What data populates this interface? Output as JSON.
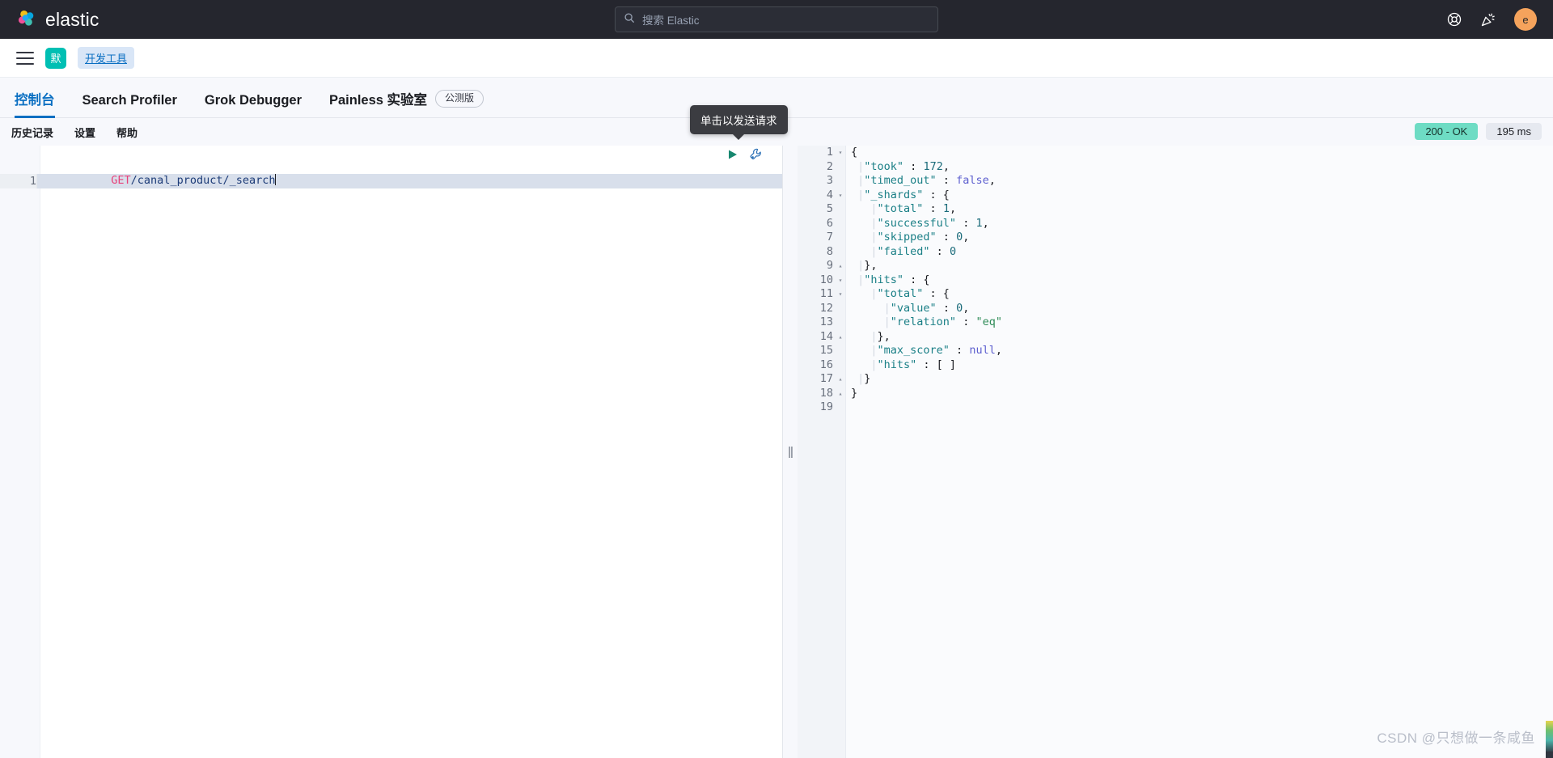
{
  "header": {
    "brand_name": "elastic",
    "logo_icon": "elastic-logo-icon",
    "search": {
      "placeholder": "搜索 Elastic",
      "value": "",
      "icon": "search-icon"
    },
    "help_icon": "lifebuoy-help-icon",
    "news_icon": "party-popper-news-icon",
    "avatar_initial": "e",
    "avatar_color": "#f5a35c",
    "background_color": "#25262e"
  },
  "breadcrumb": {
    "menu_icon": "hamburger-menu-icon",
    "space_badge": "默",
    "space_badge_color": "#00bfb3",
    "link_label": "开发工具"
  },
  "tabs": [
    {
      "label": "控制台",
      "active": true
    },
    {
      "label": "Search Profiler",
      "active": false
    },
    {
      "label": "Grok Debugger",
      "active": false
    },
    {
      "label": "Painless 实验室",
      "active": false,
      "badge": "公测版"
    }
  ],
  "console_toolbar": {
    "links": [
      "历史记录",
      "设置",
      "帮助"
    ],
    "status_code": "200 - OK",
    "status_color": "#6edcc4",
    "response_time": "195 ms"
  },
  "tooltip": {
    "text": "单击以发送请求"
  },
  "request_editor": {
    "line_number": "1",
    "method": "GET",
    "path": "/canal_product/_search",
    "send_icon": "play-send-request-icon",
    "wrench_icon": "wrench-options-icon",
    "splitter_icon": "drag-handle-icon"
  },
  "response_editor": {
    "lines": [
      {
        "n": "1",
        "fold": "▾",
        "indent": 0,
        "tokens": [
          {
            "t": "{",
            "c": "j-punc"
          }
        ]
      },
      {
        "n": "2",
        "fold": "",
        "indent": 1,
        "tokens": [
          {
            "t": "\"took\"",
            "c": "j-key"
          },
          {
            "t": " : ",
            "c": "j-punc"
          },
          {
            "t": "172",
            "c": "j-num"
          },
          {
            "t": ",",
            "c": "j-punc"
          }
        ]
      },
      {
        "n": "3",
        "fold": "",
        "indent": 1,
        "tokens": [
          {
            "t": "\"timed_out\"",
            "c": "j-key"
          },
          {
            "t": " : ",
            "c": "j-punc"
          },
          {
            "t": "false",
            "c": "j-lit"
          },
          {
            "t": ",",
            "c": "j-punc"
          }
        ]
      },
      {
        "n": "4",
        "fold": "▾",
        "indent": 1,
        "tokens": [
          {
            "t": "\"_shards\"",
            "c": "j-key"
          },
          {
            "t": " : {",
            "c": "j-punc"
          }
        ]
      },
      {
        "n": "5",
        "fold": "",
        "indent": 2,
        "tokens": [
          {
            "t": "\"total\"",
            "c": "j-key"
          },
          {
            "t": " : ",
            "c": "j-punc"
          },
          {
            "t": "1",
            "c": "j-num"
          },
          {
            "t": ",",
            "c": "j-punc"
          }
        ]
      },
      {
        "n": "6",
        "fold": "",
        "indent": 2,
        "tokens": [
          {
            "t": "\"successful\"",
            "c": "j-key"
          },
          {
            "t": " : ",
            "c": "j-punc"
          },
          {
            "t": "1",
            "c": "j-num"
          },
          {
            "t": ",",
            "c": "j-punc"
          }
        ]
      },
      {
        "n": "7",
        "fold": "",
        "indent": 2,
        "tokens": [
          {
            "t": "\"skipped\"",
            "c": "j-key"
          },
          {
            "t": " : ",
            "c": "j-punc"
          },
          {
            "t": "0",
            "c": "j-num"
          },
          {
            "t": ",",
            "c": "j-punc"
          }
        ]
      },
      {
        "n": "8",
        "fold": "",
        "indent": 2,
        "tokens": [
          {
            "t": "\"failed\"",
            "c": "j-key"
          },
          {
            "t": " : ",
            "c": "j-punc"
          },
          {
            "t": "0",
            "c": "j-num"
          }
        ]
      },
      {
        "n": "9",
        "fold": "▴",
        "indent": 1,
        "tokens": [
          {
            "t": "},",
            "c": "j-punc"
          }
        ]
      },
      {
        "n": "10",
        "fold": "▾",
        "indent": 1,
        "tokens": [
          {
            "t": "\"hits\"",
            "c": "j-key"
          },
          {
            "t": " : {",
            "c": "j-punc"
          }
        ]
      },
      {
        "n": "11",
        "fold": "▾",
        "indent": 2,
        "tokens": [
          {
            "t": "\"total\"",
            "c": "j-key"
          },
          {
            "t": " : {",
            "c": "j-punc"
          }
        ]
      },
      {
        "n": "12",
        "fold": "",
        "indent": 3,
        "tokens": [
          {
            "t": "\"value\"",
            "c": "j-key"
          },
          {
            "t": " : ",
            "c": "j-punc"
          },
          {
            "t": "0",
            "c": "j-num"
          },
          {
            "t": ",",
            "c": "j-punc"
          }
        ]
      },
      {
        "n": "13",
        "fold": "",
        "indent": 3,
        "tokens": [
          {
            "t": "\"relation\"",
            "c": "j-key"
          },
          {
            "t": " : ",
            "c": "j-punc"
          },
          {
            "t": "\"eq\"",
            "c": "j-str"
          }
        ]
      },
      {
        "n": "14",
        "fold": "▴",
        "indent": 2,
        "tokens": [
          {
            "t": "},",
            "c": "j-punc"
          }
        ]
      },
      {
        "n": "15",
        "fold": "",
        "indent": 2,
        "tokens": [
          {
            "t": "\"max_score\"",
            "c": "j-key"
          },
          {
            "t": " : ",
            "c": "j-punc"
          },
          {
            "t": "null",
            "c": "j-lit"
          },
          {
            "t": ",",
            "c": "j-punc"
          }
        ]
      },
      {
        "n": "16",
        "fold": "",
        "indent": 2,
        "tokens": [
          {
            "t": "\"hits\"",
            "c": "j-key"
          },
          {
            "t": " : [ ]",
            "c": "j-punc"
          }
        ]
      },
      {
        "n": "17",
        "fold": "▴",
        "indent": 1,
        "tokens": [
          {
            "t": "}",
            "c": "j-punc"
          }
        ]
      },
      {
        "n": "18",
        "fold": "▴",
        "indent": 0,
        "tokens": [
          {
            "t": "}",
            "c": "j-punc"
          }
        ]
      },
      {
        "n": "19",
        "fold": "",
        "indent": 0,
        "tokens": []
      }
    ]
  },
  "watermark": {
    "text": "CSDN @只想做一条咸鱼"
  }
}
